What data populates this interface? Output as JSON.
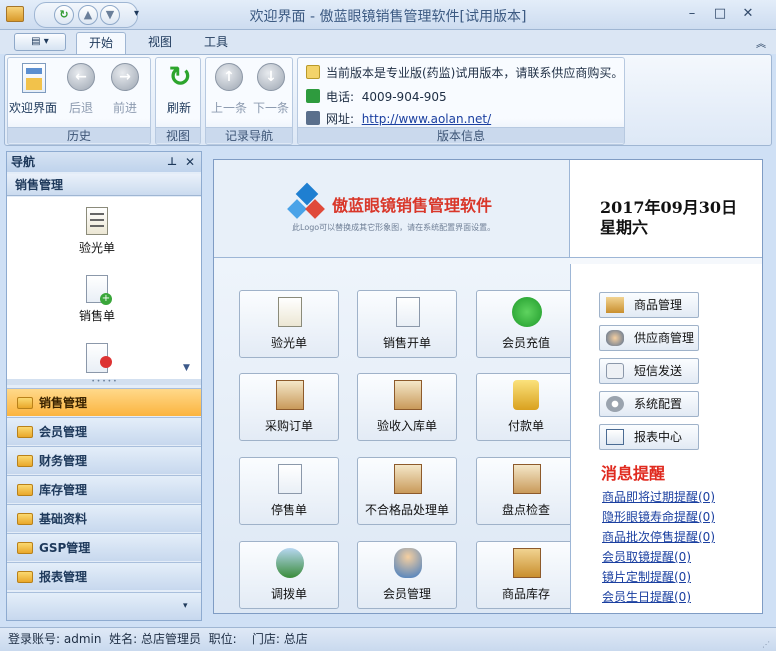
{
  "window": {
    "title": "欢迎界面 - 傲蓝眼镜销售管理软件[试用版本]"
  },
  "ribbon": {
    "tabs": [
      "开始",
      "视图",
      "工具"
    ],
    "groups": {
      "history": "历史",
      "view": "视图",
      "record_nav": "记录导航",
      "version": "版本信息"
    },
    "buttons": {
      "welcome": "欢迎界面",
      "back": "后退",
      "forward": "前进",
      "refresh": "刷新",
      "prev": "上一条",
      "next": "下一条"
    },
    "info": {
      "notice": "当前版本是专业版(药监)试用版本，请联系供应商购买。",
      "phone_label": "电话:",
      "phone": "4009-904-905",
      "site_label": "网址:",
      "site": "http://www.aolan.net/"
    }
  },
  "nav": {
    "title": "导航",
    "section": "销售管理",
    "items": [
      "验光单",
      "销售单"
    ],
    "groups": [
      "销售管理",
      "会员管理",
      "财务管理",
      "库存管理",
      "基础资料",
      "GSP管理",
      "报表管理"
    ]
  },
  "main": {
    "logo_title": "傲蓝眼镜销售管理软件",
    "logo_sub": "此Logo可以替换成其它形象图，请在系统配置界面设置。",
    "date": "2017年09月30日",
    "weekday": "星期六",
    "tiles": [
      "验光单",
      "销售开单",
      "会员充值",
      "采购订单",
      "验收入库单",
      "付款单",
      "停售单",
      "不合格品处理单",
      "盘点检查",
      "调拨单",
      "会员管理",
      "商品库存"
    ],
    "side_buttons": [
      "商品管理",
      "供应商管理",
      "短信发送",
      "系统配置",
      "报表中心"
    ],
    "msg_title": "消息提醒",
    "messages": [
      "商品即将过期提醒(0)",
      "隐形眼镜寿命提醒(0)",
      "商品批次停售提醒(0)",
      "会员取镜提醒(0)",
      "镜片定制提醒(0)",
      "会员生日提醒(0)"
    ]
  },
  "status": {
    "text": "登录账号: admin  姓名: 总店管理员  职位:    门店: 总店"
  }
}
